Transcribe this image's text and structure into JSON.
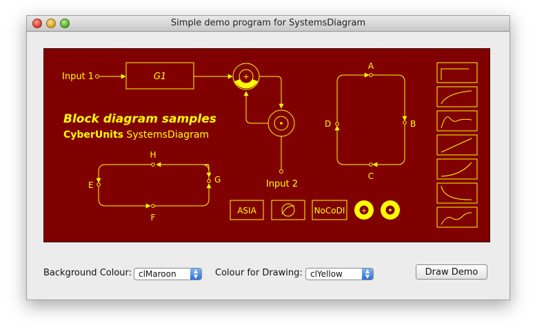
{
  "window": {
    "title": "Simple demo program for SystemsDiagram"
  },
  "diagram": {
    "colors": {
      "background": "#800000",
      "drawing": "#ffff00"
    },
    "input1_label": "Input 1",
    "input2_label": "Input 2",
    "g1_label": "G1",
    "plus_sign": "+",
    "heading": "Block diagram samples",
    "subheading_bold": "CyberUnits",
    "subheading_normal": " SystemsDiagram",
    "loop1": {
      "a": "A",
      "b": "B",
      "c": "C",
      "d": "D"
    },
    "loop2": {
      "e": "E",
      "f": "F",
      "g": "G",
      "h": "H"
    },
    "legend_asia": "ASIA",
    "legend_nocodi": "NoCoDI"
  },
  "controls": {
    "background_label": "Background Colour:",
    "background_value": "clMaroon",
    "drawing_label": "Colour for Drawing:",
    "drawing_value": "clYellow",
    "draw_button": "Draw Demo"
  }
}
